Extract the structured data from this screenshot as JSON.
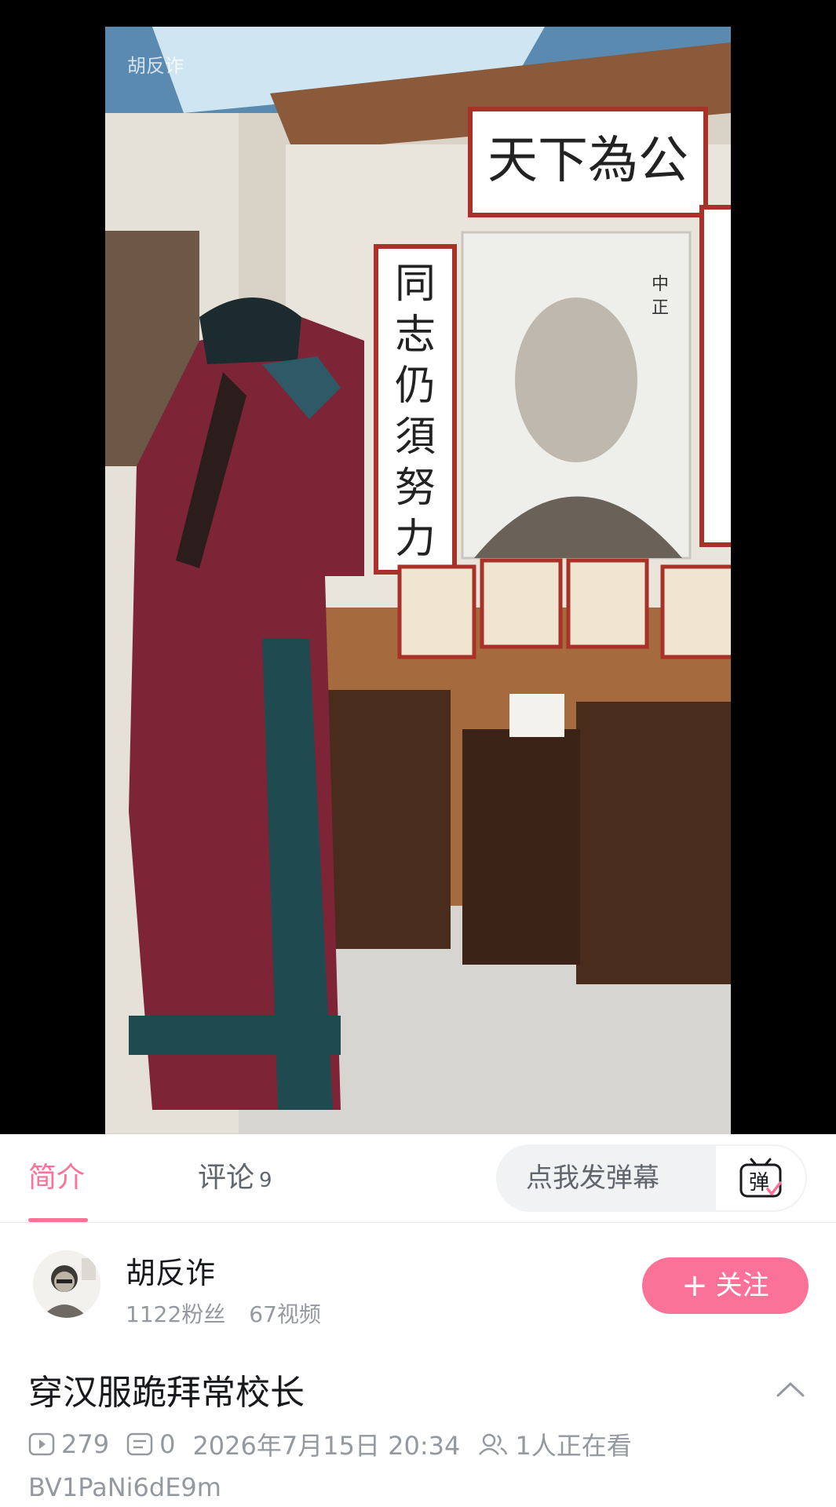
{
  "video": {
    "watermark": "胡反诈"
  },
  "tabs": {
    "intro_label": "简介",
    "comments_label": "评论",
    "comments_count": "9"
  },
  "danmaku": {
    "placeholder": "点我发弹幕",
    "button_glyph": "弹"
  },
  "uploader": {
    "name": "胡反诈",
    "fans": "1122粉丝",
    "videos": "67视频",
    "follow_label": "关注",
    "follow_plus": "+"
  },
  "title": "穿汉服跪拜常校长",
  "meta": {
    "views": "279",
    "danmaku_count": "0",
    "datetime": "2026年7月15日 20:34",
    "watching": "1人正在看"
  },
  "bvid": "BV1PaNi6dE9m",
  "scene_text": {
    "plaque": "天下為公",
    "couplet": "同志仍須努力",
    "portrait_caption": "中正"
  },
  "colors": {
    "accent": "#fb7299",
    "text_primary": "#18191c",
    "text_secondary": "#9499a0"
  },
  "icons": [
    "play-count-icon",
    "danmaku-count-icon",
    "watching-icon",
    "danmaku-tv-icon",
    "chevron-up-icon"
  ]
}
